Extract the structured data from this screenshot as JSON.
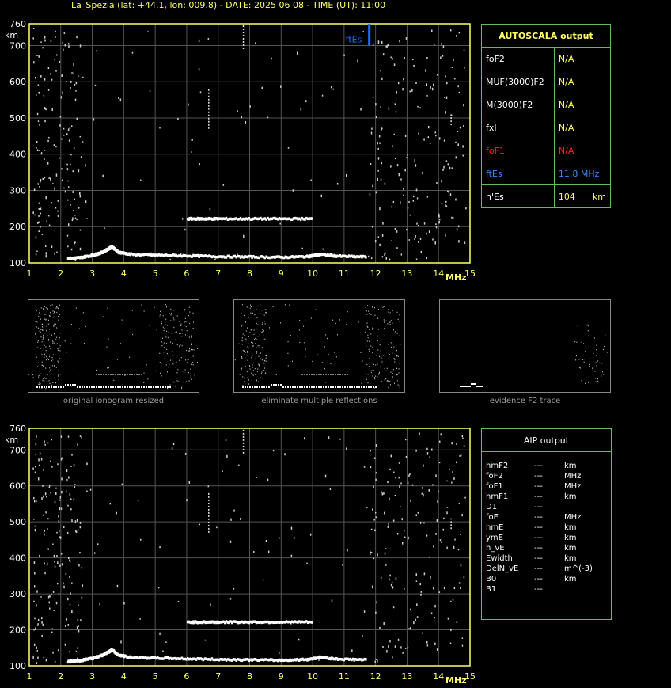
{
  "header": "La_Spezia (lat: +44.1, lon: 009.8) - DATE: 2025 06 08 - TIME (UT): 11:00",
  "chart_data": [
    {
      "type": "scatter",
      "title": "",
      "xlabel": "MHz",
      "ylabel": "km",
      "xlim": [
        1,
        15
      ],
      "ylim": [
        100,
        760
      ],
      "x_ticks": [
        "1",
        "2",
        "3",
        "4",
        "5",
        "6",
        "7",
        "8",
        "9",
        "10",
        "11",
        "12",
        "13",
        "14",
        "15"
      ],
      "y_ticks": [
        "100",
        "200",
        "300",
        "400",
        "500",
        "600",
        "700",
        "760"
      ],
      "traces": [
        {
          "name": "E-layer",
          "x": [
            2.2,
            2.6,
            3.0,
            3.3,
            3.5,
            3.6,
            3.8,
            4.2,
            5,
            6,
            7,
            8,
            9,
            9.8,
            10.2,
            10.8,
            11.7
          ],
          "y": [
            112,
            115,
            122,
            130,
            140,
            145,
            130,
            124,
            122,
            120,
            118,
            117,
            116,
            118,
            124,
            119,
            117
          ]
        },
        {
          "name": "Es-trace",
          "x": [
            6.0,
            6.5,
            7.0,
            8.0,
            9.0,
            10.0
          ],
          "y": [
            222,
            222,
            222,
            222,
            222,
            222
          ]
        }
      ],
      "markers": [
        {
          "label": "ftEs",
          "x": 11.8,
          "color": "#1e6fff"
        }
      ]
    },
    {
      "type": "scatter",
      "title": "",
      "xlabel": "MHz",
      "ylabel": "km",
      "xlim": [
        1,
        15
      ],
      "ylim": [
        100,
        760
      ],
      "x_ticks": [
        "1",
        "2",
        "3",
        "4",
        "5",
        "6",
        "7",
        "8",
        "9",
        "10",
        "11",
        "12",
        "13",
        "14",
        "15"
      ],
      "y_ticks": [
        "100",
        "200",
        "300",
        "400",
        "500",
        "600",
        "700",
        "760"
      ]
    }
  ],
  "autoscala": {
    "title": "AUTOSCALA output",
    "rows": [
      {
        "label": "foF2",
        "value": "N/A",
        "color": "#ffff66"
      },
      {
        "label": "MUF(3000)F2",
        "value": "N/A",
        "color": "#ffff66"
      },
      {
        "label": "M(3000)F2",
        "value": "N/A",
        "color": "#ffff66"
      },
      {
        "label": "fxI",
        "value": "N/A",
        "color": "#ffff66"
      },
      {
        "label": "foF1",
        "value": "N/A",
        "color": "#ff2020"
      },
      {
        "label": "ftEs",
        "value": "11.8 MHz",
        "color": "#3a8cff"
      },
      {
        "label": "h'Es",
        "value": "104",
        "unit": "km",
        "color": "#ffff66"
      }
    ]
  },
  "thumbnails": [
    {
      "caption": "original ionogram resized"
    },
    {
      "caption": "eliminate multiple reflections"
    },
    {
      "caption": "evidence F2 trace"
    }
  ],
  "aip": {
    "title": "AIP output",
    "rows": [
      {
        "param": "hmF2",
        "value": "---",
        "unit": "km"
      },
      {
        "param": "foF2",
        "value": "---",
        "unit": "MHz"
      },
      {
        "param": "foF1",
        "value": "---",
        "unit": "MHz"
      },
      {
        "param": "hmF1",
        "value": "---",
        "unit": "km"
      },
      {
        "param": "D1",
        "value": "---",
        "unit": ""
      },
      {
        "param": "foE",
        "value": "---",
        "unit": "MHz"
      },
      {
        "param": "hmE",
        "value": "---",
        "unit": "km"
      },
      {
        "param": "ymE",
        "value": "---",
        "unit": "km"
      },
      {
        "param": "h_vE",
        "value": "---",
        "unit": "km"
      },
      {
        "param": "Ewidth",
        "value": "---",
        "unit": "km"
      },
      {
        "param": "DelN_vE",
        "value": "---",
        "unit": "m^(-3)"
      },
      {
        "param": "B0",
        "value": "---",
        "unit": "km"
      },
      {
        "param": "B1",
        "value": "---",
        "unit": ""
      }
    ]
  },
  "colors": {
    "axis": "#ffff66",
    "grid": "#555555",
    "panel_border": "#5fbf5f"
  }
}
